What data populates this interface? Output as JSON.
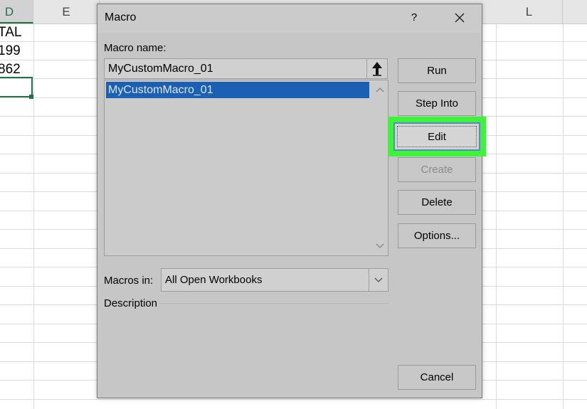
{
  "spreadsheet": {
    "column_headers": [
      "D",
      "E",
      "L"
    ],
    "cells": [
      "TAL",
      "199",
      "862"
    ]
  },
  "dialog": {
    "title": "Macro",
    "help_label": "?",
    "macro_name_label": "Macro name:",
    "macro_name_value": "MyCustomMacro_01",
    "macro_list": [
      "MyCustomMacro_01"
    ],
    "buttons": {
      "run": "Run",
      "step_into": "Step Into",
      "edit": "Edit",
      "create": "Create",
      "delete": "Delete",
      "options": "Options...",
      "cancel": "Cancel"
    },
    "macros_in_label": "Macros in:",
    "macros_in_value": "All Open Workbooks",
    "description_label": "Description"
  },
  "colors": {
    "highlight": "#3ff23a",
    "selection": "#1c60b3",
    "excel_green": "#217346"
  },
  "icons": [
    "close-icon",
    "arrow-up-icon",
    "chevron-down-icon",
    "scroll-up-icon",
    "scroll-down-icon"
  ]
}
